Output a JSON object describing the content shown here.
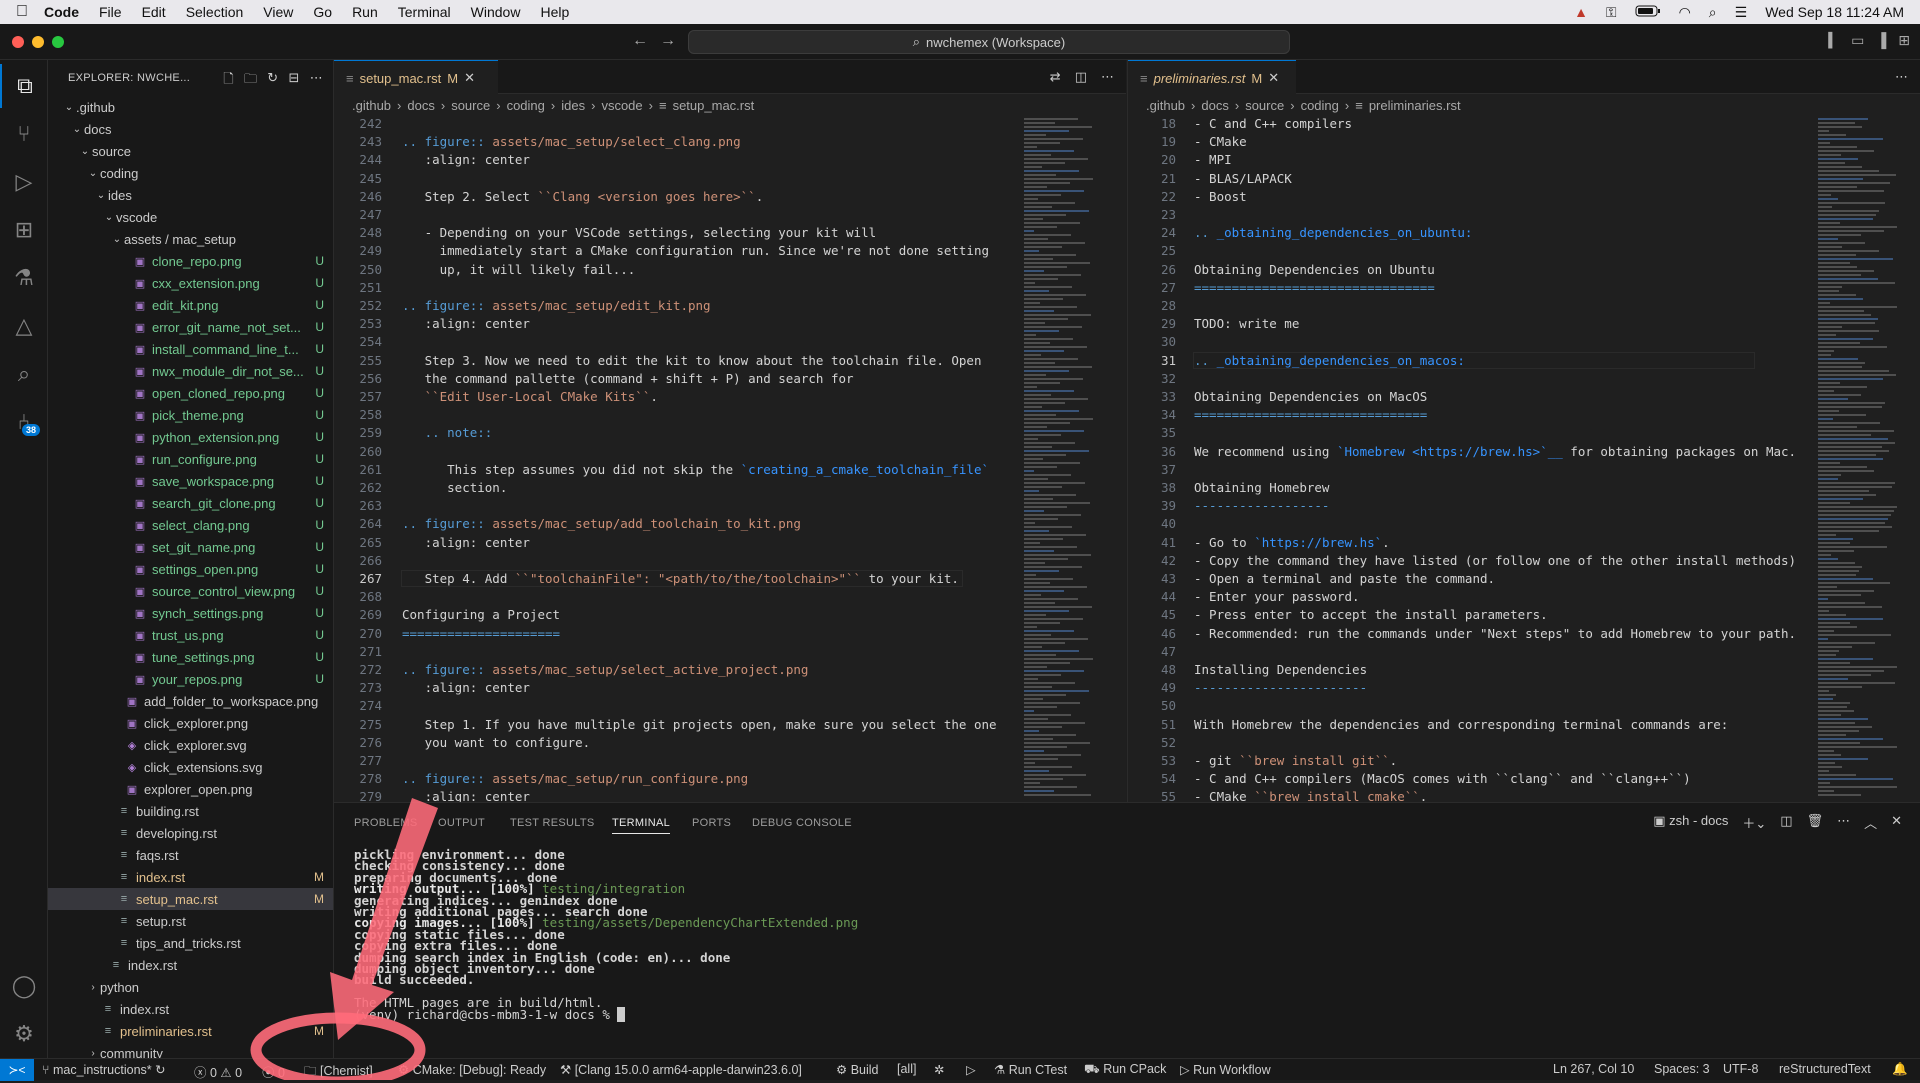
{
  "menubar": {
    "app": "Code",
    "items": [
      "File",
      "Edit",
      "Selection",
      "View",
      "Go",
      "Run",
      "Terminal",
      "Window",
      "Help"
    ],
    "datetime": "Wed Sep 18  11:24 AM"
  },
  "titlebar": {
    "search": "nwchemex (Workspace)"
  },
  "activity": {
    "badge": "38"
  },
  "explorer": {
    "title": "EXPLORER: NWCHE...",
    "rows": [
      {
        "label": ".github",
        "indent": 0,
        "type": "folder",
        "open": true,
        "deco": "dot"
      },
      {
        "label": "docs",
        "indent": 1,
        "type": "folder",
        "open": true,
        "deco": "dot"
      },
      {
        "label": "source",
        "indent": 2,
        "type": "folder",
        "open": true,
        "deco": "dot"
      },
      {
        "label": "coding",
        "indent": 3,
        "type": "folder",
        "open": true,
        "deco": "dot"
      },
      {
        "label": "ides",
        "indent": 4,
        "type": "folder",
        "open": true,
        "deco": "dot"
      },
      {
        "label": "vscode",
        "indent": 5,
        "type": "folder",
        "open": true,
        "deco": "dot"
      },
      {
        "label": "assets / mac_setup",
        "indent": 6,
        "type": "folder",
        "open": true,
        "deco": "dot"
      },
      {
        "label": "clone_repo.png",
        "indent": 7,
        "type": "img",
        "deco": "U"
      },
      {
        "label": "cxx_extension.png",
        "indent": 7,
        "type": "img",
        "deco": "U"
      },
      {
        "label": "edit_kit.png",
        "indent": 7,
        "type": "img",
        "deco": "U"
      },
      {
        "label": "error_git_name_not_set...",
        "indent": 7,
        "type": "img",
        "deco": "U"
      },
      {
        "label": "install_command_line_t...",
        "indent": 7,
        "type": "img",
        "deco": "U"
      },
      {
        "label": "nwx_module_dir_not_se...",
        "indent": 7,
        "type": "img",
        "deco": "U"
      },
      {
        "label": "open_cloned_repo.png",
        "indent": 7,
        "type": "img",
        "deco": "U"
      },
      {
        "label": "pick_theme.png",
        "indent": 7,
        "type": "img",
        "deco": "U"
      },
      {
        "label": "python_extension.png",
        "indent": 7,
        "type": "img",
        "deco": "U"
      },
      {
        "label": "run_configure.png",
        "indent": 7,
        "type": "img",
        "deco": "U"
      },
      {
        "label": "save_workspace.png",
        "indent": 7,
        "type": "img",
        "deco": "U"
      },
      {
        "label": "search_git_clone.png",
        "indent": 7,
        "type": "img",
        "deco": "U"
      },
      {
        "label": "select_clang.png",
        "indent": 7,
        "type": "img",
        "deco": "U"
      },
      {
        "label": "set_git_name.png",
        "indent": 7,
        "type": "img",
        "deco": "U"
      },
      {
        "label": "settings_open.png",
        "indent": 7,
        "type": "img",
        "deco": "U"
      },
      {
        "label": "source_control_view.png",
        "indent": 7,
        "type": "img",
        "deco": "U"
      },
      {
        "label": "synch_settings.png",
        "indent": 7,
        "type": "img",
        "deco": "U"
      },
      {
        "label": "trust_us.png",
        "indent": 7,
        "type": "img",
        "deco": "U"
      },
      {
        "label": "tune_settings.png",
        "indent": 7,
        "type": "img",
        "deco": "U"
      },
      {
        "label": "your_repos.png",
        "indent": 7,
        "type": "img",
        "deco": "U"
      },
      {
        "label": "add_folder_to_workspace.png",
        "indent": 6,
        "type": "img",
        "deco": ""
      },
      {
        "label": "click_explorer.png",
        "indent": 6,
        "type": "img",
        "deco": ""
      },
      {
        "label": "click_explorer.svg",
        "indent": 6,
        "type": "svg",
        "deco": ""
      },
      {
        "label": "click_extensions.svg",
        "indent": 6,
        "type": "svg",
        "deco": ""
      },
      {
        "label": "explorer_open.png",
        "indent": 6,
        "type": "img",
        "deco": ""
      },
      {
        "label": "building.rst",
        "indent": 5,
        "type": "file",
        "deco": ""
      },
      {
        "label": "developing.rst",
        "indent": 5,
        "type": "file",
        "deco": ""
      },
      {
        "label": "faqs.rst",
        "indent": 5,
        "type": "file",
        "deco": ""
      },
      {
        "label": "index.rst",
        "indent": 5,
        "type": "file",
        "deco": "M"
      },
      {
        "label": "setup_mac.rst",
        "indent": 5,
        "type": "file",
        "deco": "M",
        "selected": true
      },
      {
        "label": "setup.rst",
        "indent": 5,
        "type": "file",
        "deco": ""
      },
      {
        "label": "tips_and_tricks.rst",
        "indent": 5,
        "type": "file",
        "deco": ""
      },
      {
        "label": "index.rst",
        "indent": 4,
        "type": "file",
        "deco": ""
      },
      {
        "label": "python",
        "indent": 3,
        "type": "folder",
        "open": false,
        "deco": ""
      },
      {
        "label": "index.rst",
        "indent": 3,
        "type": "file",
        "deco": ""
      },
      {
        "label": "preliminaries.rst",
        "indent": 3,
        "type": "file",
        "deco": "M"
      },
      {
        "label": "community",
        "indent": 3,
        "type": "folder",
        "open": false,
        "deco": ""
      }
    ]
  },
  "editor1": {
    "tab": "setup_mac.rst",
    "tab_status": "M",
    "crumbs": [
      ".github",
      "docs",
      "source",
      "coding",
      "ides",
      "vscode",
      "setup_mac.rst"
    ],
    "lines": [
      {
        "n": "242",
        "t": ""
      },
      {
        "n": "243",
        "t": ".. figure:: assets/mac_setup/select_clang.png",
        "k": "fig"
      },
      {
        "n": "244",
        "t": "   :align: center"
      },
      {
        "n": "245",
        "t": ""
      },
      {
        "n": "246",
        "t": "   Step 2. Select ``Clang <version goes here>``.",
        "k": "lit",
        "lit": "``Clang <version goes here>``",
        "pre": "   Step 2. Select ",
        "post": "."
      },
      {
        "n": "247",
        "t": ""
      },
      {
        "n": "248",
        "t": "   - Depending on your VSCode settings, selecting your kit will"
      },
      {
        "n": "249",
        "t": "     immediately start a CMake configuration run. Since we're not done setting"
      },
      {
        "n": "250",
        "t": "     up, it will likely fail..."
      },
      {
        "n": "251",
        "t": ""
      },
      {
        "n": "252",
        "t": ".. figure:: assets/mac_setup/edit_kit.png",
        "k": "fig"
      },
      {
        "n": "253",
        "t": "   :align: center"
      },
      {
        "n": "254",
        "t": ""
      },
      {
        "n": "255",
        "t": "   Step 3. Now we need to edit the kit to know about the toolchain file. Open"
      },
      {
        "n": "256",
        "t": "   the command pallette (command + shift + P) and search for"
      },
      {
        "n": "257",
        "t": "   ``Edit User-Local CMake Kits``.",
        "k": "lit",
        "lit": "``Edit User-Local CMake Kits``",
        "pre": "   ",
        "post": "."
      },
      {
        "n": "258",
        "t": ""
      },
      {
        "n": "259",
        "t": "   .. note::",
        "k": "note"
      },
      {
        "n": "260",
        "t": ""
      },
      {
        "n": "261",
        "t": "      This step assumes you did not skip the `creating_a_cmake_toolchain_file`",
        "k": "ref",
        "lit": "`creating_a_cmake_toolchain_file`",
        "pre": "      This step assumes you did not skip the ",
        "post": ""
      },
      {
        "n": "262",
        "t": "      section."
      },
      {
        "n": "263",
        "t": ""
      },
      {
        "n": "264",
        "t": ".. figure:: assets/mac_setup/add_toolchain_to_kit.png",
        "k": "fig"
      },
      {
        "n": "265",
        "t": "   :align: center"
      },
      {
        "n": "266",
        "t": ""
      },
      {
        "n": "267",
        "t": "   Step 4. Add ``\"toolchainFile\": \"<path/to/the/toolchain>\"`` to your kit.",
        "k": "lit",
        "lit": "``\"toolchainFile\": \"<path/to/the/toolchain>\"``",
        "pre": "   Step 4. Add ",
        "post": " to your kit.",
        "cur": true
      },
      {
        "n": "268",
        "t": ""
      },
      {
        "n": "269",
        "t": "Configuring a Project"
      },
      {
        "n": "270",
        "t": "=====================",
        "k": "ul"
      },
      {
        "n": "271",
        "t": ""
      },
      {
        "n": "272",
        "t": ".. figure:: assets/mac_setup/select_active_project.png",
        "k": "fig"
      },
      {
        "n": "273",
        "t": "   :align: center"
      },
      {
        "n": "274",
        "t": ""
      },
      {
        "n": "275",
        "t": "   Step 1. If you have multiple git projects open, make sure you select the one"
      },
      {
        "n": "276",
        "t": "   you want to configure."
      },
      {
        "n": "277",
        "t": ""
      },
      {
        "n": "278",
        "t": ".. figure:: assets/mac_setup/run_configure.png",
        "k": "fig"
      },
      {
        "n": "279",
        "t": "   :align: center"
      }
    ]
  },
  "editor2": {
    "tab": "preliminaries.rst",
    "tab_status": "M",
    "crumbs": [
      ".github",
      "docs",
      "source",
      "coding",
      "preliminaries.rst"
    ],
    "lines": [
      {
        "n": "18",
        "t": "- C and C++ compilers"
      },
      {
        "n": "19",
        "t": "- CMake"
      },
      {
        "n": "20",
        "t": "- MPI"
      },
      {
        "n": "21",
        "t": "- BLAS/LAPACK"
      },
      {
        "n": "22",
        "t": "- Boost"
      },
      {
        "n": "23",
        "t": ""
      },
      {
        "n": "24",
        "t": ".. _obtaining_dependencies_on_ubuntu:",
        "k": "label"
      },
      {
        "n": "25",
        "t": ""
      },
      {
        "n": "26",
        "t": "Obtaining Dependencies on Ubuntu"
      },
      {
        "n": "27",
        "t": "================================",
        "k": "ul"
      },
      {
        "n": "28",
        "t": ""
      },
      {
        "n": "29",
        "t": "TODO: write me"
      },
      {
        "n": "30",
        "t": ""
      },
      {
        "n": "31",
        "t": ".. _obtaining_dependencies_on_macos:",
        "k": "label",
        "cur": true
      },
      {
        "n": "32",
        "t": ""
      },
      {
        "n": "33",
        "t": "Obtaining Dependencies on MacOS"
      },
      {
        "n": "34",
        "t": "===============================",
        "k": "ul"
      },
      {
        "n": "35",
        "t": ""
      },
      {
        "n": "36",
        "t": "We recommend using `Homebrew <https://brew.hs>`__ for obtaining packages on Mac.",
        "k": "ref",
        "lit": "`Homebrew <https://brew.hs>`__",
        "pre": "We recommend using ",
        "post": " for obtaining packages on Mac."
      },
      {
        "n": "37",
        "t": ""
      },
      {
        "n": "38",
        "t": "Obtaining Homebrew"
      },
      {
        "n": "39",
        "t": "------------------",
        "k": "ul"
      },
      {
        "n": "40",
        "t": ""
      },
      {
        "n": "41",
        "t": "- Go to `https://brew.hs`.",
        "k": "ref",
        "lit": "`https://brew.hs`",
        "pre": "- Go to ",
        "post": "."
      },
      {
        "n": "42",
        "t": "- Copy the command they have listed (or follow one of the other install methods)"
      },
      {
        "n": "43",
        "t": "- Open a terminal and paste the command."
      },
      {
        "n": "44",
        "t": "- Enter your password."
      },
      {
        "n": "45",
        "t": "- Press enter to accept the install parameters."
      },
      {
        "n": "46",
        "t": "- Recommended: run the commands under \"Next steps\" to add Homebrew to your path."
      },
      {
        "n": "47",
        "t": ""
      },
      {
        "n": "48",
        "t": "Installing Dependencies"
      },
      {
        "n": "49",
        "t": "-----------------------",
        "k": "ul"
      },
      {
        "n": "50",
        "t": ""
      },
      {
        "n": "51",
        "t": "With Homebrew the dependencies and corresponding terminal commands are:"
      },
      {
        "n": "52",
        "t": ""
      },
      {
        "n": "53",
        "t": "- git ``brew install git``.",
        "k": "lit",
        "lit": "``brew install git``",
        "pre": "- git ",
        "post": "."
      },
      {
        "n": "54",
        "t": "- C and C++ compilers (MacOS comes with ``clang`` and ``clang++``)"
      },
      {
        "n": "55",
        "t": "- CMake ``brew install cmake``.",
        "k": "lit",
        "lit": "``brew install cmake``",
        "pre": "- CMake ",
        "post": "."
      }
    ]
  },
  "panel": {
    "tabs": [
      "PROBLEMS",
      "OUTPUT",
      "TEST RESULTS",
      "TERMINAL",
      "PORTS",
      "DEBUG CONSOLE"
    ],
    "active": "TERMINAL",
    "shell": "zsh - docs",
    "terminal": [
      {
        "t": "pickling environment... done"
      },
      {
        "t": "checking consistency... done"
      },
      {
        "t": "preparing documents... done"
      },
      {
        "t": "writing output... [100%] ",
        "hl": "testing/integration"
      },
      {
        "t": "generating indices... genindex done"
      },
      {
        "t": "writing additional pages... search done"
      },
      {
        "t": "copying images... [100%] ",
        "hl": "testing/assets/DependencyChartExtended.png"
      },
      {
        "t": "copying static files... done"
      },
      {
        "t": "copying extra files... done"
      },
      {
        "t": "dumping search index in English (code: en)... done"
      },
      {
        "t": "dumping object inventory... done"
      },
      {
        "t": "build succeeded."
      },
      {
        "t": ""
      },
      {
        "t": "The HTML pages are in build/html."
      },
      {
        "t": "(venv) richard@cbs-mbm3-1-w docs % "
      }
    ]
  },
  "statusbar": {
    "branch": "mac_instructions*",
    "problems": "0",
    "warnings": "0",
    "ports": "0",
    "kit_scope": "[Chemist]",
    "cmake": "CMake: [Debug]: Ready",
    "kit": "[Clang 15.0.0 arm64-apple-darwin23.6.0]",
    "build": "Build",
    "target": "[all]",
    "ctest": "Run CTest",
    "cpack": "Run CPack",
    "workflow": "Run Workflow",
    "position": "Ln 267, Col 10",
    "spaces": "Spaces: 3",
    "encoding": "UTF-8",
    "language": "reStructuredText"
  },
  "colors": {
    "accent": "#0078d4",
    "untracked": "#73c991",
    "modified": "#e2c08d",
    "annotation": "#ff6b7a"
  }
}
